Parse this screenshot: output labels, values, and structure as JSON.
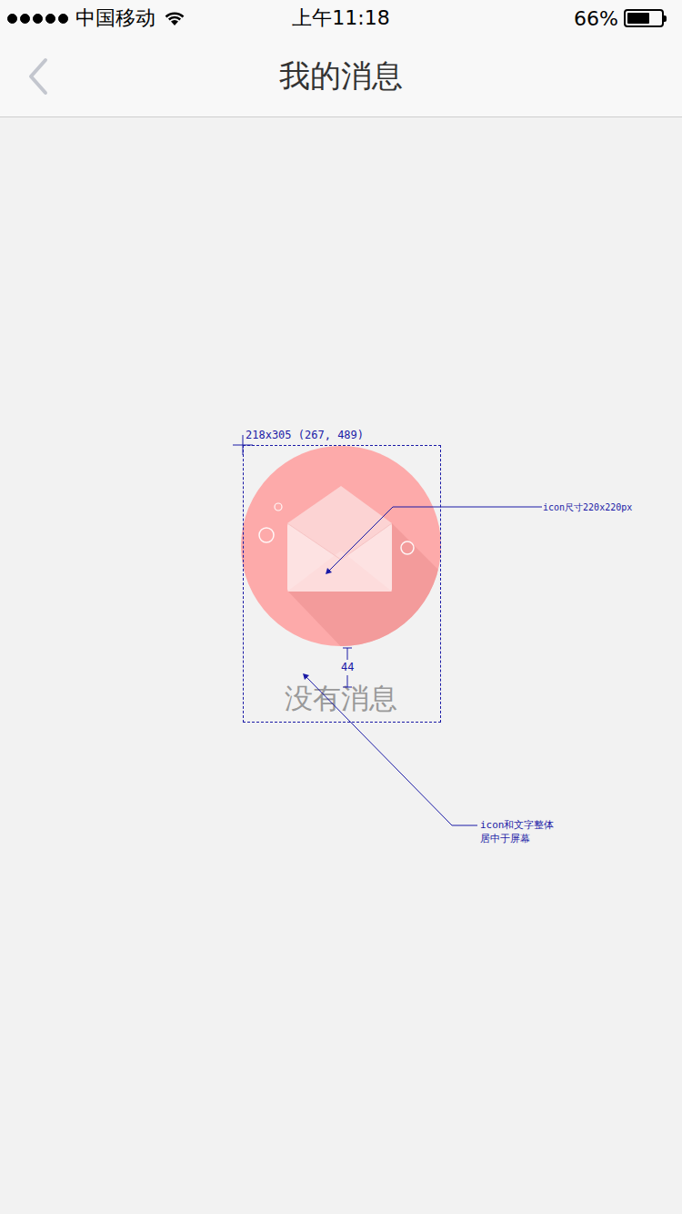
{
  "status_bar": {
    "signal": 5,
    "carrier": "中国移动",
    "time": "上午11:18",
    "battery_text": "66%",
    "battery_level": 0.66
  },
  "nav": {
    "title": "我的消息"
  },
  "empty_state": {
    "text": "没有消息"
  },
  "annotations": {
    "frame_label": "218x305 (267, 489)",
    "icon_size_label": "icon尺寸220x220px",
    "spacing_label": "44",
    "center_note": [
      "icon和文字整体",
      "居中于屏幕"
    ]
  }
}
